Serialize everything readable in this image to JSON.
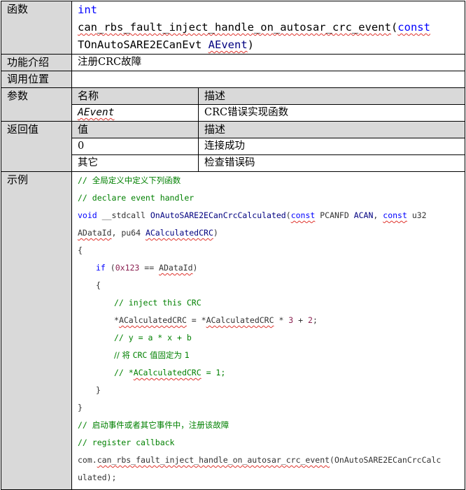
{
  "labels": {
    "function": "函数",
    "intro": "功能介绍",
    "call_location": "调用位置",
    "params": "参数",
    "return": "返回值",
    "example": "示例"
  },
  "signature": {
    "ret_type": "int",
    "name": "can_rbs_fault_inject_handle_on_autosar_crc_event",
    "open": "(",
    "const": "const",
    "param_type": "TOnAutoSARE2ECanEvt",
    "param_name": "AEvent",
    "close": ")"
  },
  "intro": "注册CRC故障",
  "call_location": "",
  "params_table": {
    "header_name": "名称",
    "header_desc": "描述",
    "rows": [
      {
        "name": "AEvent",
        "desc": "CRC错误实现函数"
      }
    ]
  },
  "return_table": {
    "header_value": "值",
    "header_desc": "描述",
    "rows": [
      {
        "value": "0",
        "desc": "连接成功"
      },
      {
        "value": "其它",
        "desc": "检查错误码"
      }
    ]
  },
  "example": {
    "l1_a": "// ",
    "l1_b": "全局定义中定义下列函数",
    "l2": "// declare event handler",
    "l3_void": "void",
    "l3_a": " __stdcall ",
    "l3_fn": "OnAutoSARE2ECanCrcCalculated",
    "l3_b": "(",
    "l3_const1": "const",
    "l3_c": " PCANFD ",
    "l3_acan": "ACAN",
    "l3_d": ", ",
    "l3_const2": "const",
    "l3_e": " u32",
    "l4_adataid": "ADataId",
    "l4_a": ", pu64 ",
    "l4_acalc": "ACalculatedCRC",
    "l4_b": ")",
    "l5": "{",
    "l6_if": "if",
    "l6_a": " (",
    "l6_num": "0x123",
    "l6_b": " == ",
    "l6_var": "ADataId",
    "l6_c": ")",
    "l7": "{",
    "l8": "// inject this CRC",
    "l9_a": "*",
    "l9_v1": "ACalculatedCRC",
    "l9_b": " = *",
    "l9_v2": "ACalculatedCRC",
    "l9_c": " * ",
    "l9_n1": "3",
    "l9_d": " + ",
    "l9_n2": "2",
    "l9_e": ";",
    "l10": "// y = a * x + b",
    "l11_a": "// 将 ",
    "l11_b": "CRC",
    "l11_c": " 值固定为 1",
    "l12_a": "// *",
    "l12_v": "ACalculatedCRC",
    "l12_b": " = 1;",
    "l13": "}",
    "l14": "}",
    "l15_a": "// ",
    "l15_b": "启动事件或者其它事件中，注册该故障",
    "l16": "// register callback",
    "l17_a": "com.",
    "l17_fn": "can_rbs_fault_inject_handle_on_autosar_crc_event",
    "l17_b": "(OnAutoSARE2ECanCrcCalc",
    "l18": "ulated);"
  }
}
